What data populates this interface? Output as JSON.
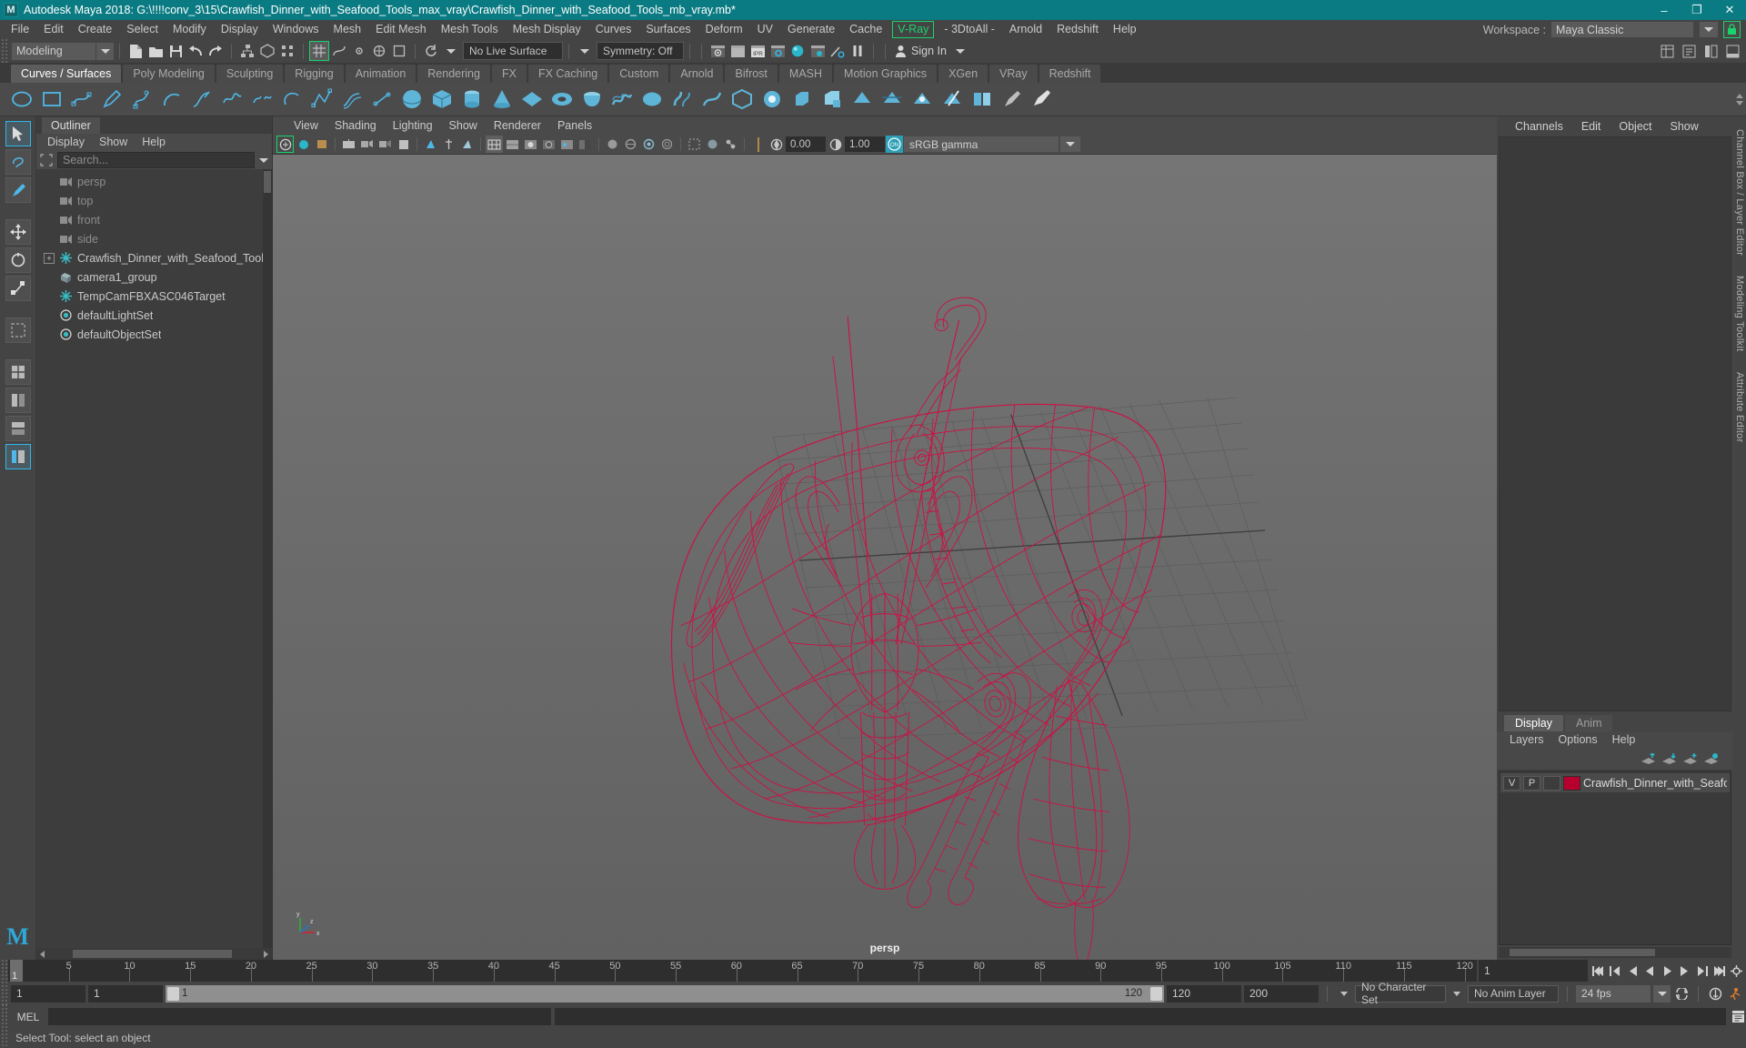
{
  "titlebar": {
    "app_title": "Autodesk Maya 2018: G:\\!!!!conv_3\\15\\Crawfish_Dinner_with_Seafood_Tools_max_vray\\Crawfish_Dinner_with_Seafood_Tools_mb_vray.mb*",
    "logo": "M",
    "minimize": "–",
    "maximize": "❐",
    "close": "✕",
    "bg_color": "#0a7b82"
  },
  "menubar": {
    "items": [
      "File",
      "Edit",
      "Create",
      "Select",
      "Modify",
      "Display",
      "Windows",
      "Mesh",
      "Edit Mesh",
      "Mesh Tools",
      "Mesh Display",
      "Curves",
      "Surfaces",
      "Deform",
      "UV",
      "Generate",
      "Cache"
    ],
    "vray": "V-Ray",
    "vray_color": "#19d36c",
    "after_vray": [
      "- 3DtoAll -",
      "Arnold",
      "Redshift",
      "Help"
    ],
    "workspace_label": "Workspace :",
    "workspace_value": "Maya Classic",
    "lock_icon": "lock-icon"
  },
  "statusline": {
    "mode_value": "Modeling",
    "no_live_surface": "No Live Surface",
    "symmetry": "Symmetry: Off",
    "sign_in": "Sign In"
  },
  "shelf": {
    "tabs": [
      "Curves / Surfaces",
      "Poly Modeling",
      "Sculpting",
      "Rigging",
      "Animation",
      "Rendering",
      "FX",
      "FX Caching",
      "Custom",
      "Arnold",
      "Bifrost",
      "MASH",
      "Motion Graphics",
      "XGen",
      "VRay",
      "Redshift"
    ],
    "active_tab": "Curves / Surfaces"
  },
  "outliner": {
    "tab": "Outliner",
    "menus": [
      "Display",
      "Show",
      "Help"
    ],
    "search_placeholder": "Search...",
    "items": [
      {
        "label": "persp",
        "icon": "camera-icon",
        "dim": true,
        "expand": false
      },
      {
        "label": "top",
        "icon": "camera-icon",
        "dim": true,
        "expand": false
      },
      {
        "label": "front",
        "icon": "camera-icon",
        "dim": true,
        "expand": false
      },
      {
        "label": "side",
        "icon": "camera-icon",
        "dim": true,
        "expand": false
      },
      {
        "label": "Crawfish_Dinner_with_Seafood_Tools",
        "icon": "transform-icon",
        "dim": false,
        "expand": true
      },
      {
        "label": "camera1_group",
        "icon": "group-icon",
        "dim": false,
        "expand": false
      },
      {
        "label": "TempCamFBXASC046Target",
        "icon": "transform-icon",
        "dim": false,
        "expand": false
      },
      {
        "label": "defaultLightSet",
        "icon": "set-icon",
        "dim": false,
        "expand": false
      },
      {
        "label": "defaultObjectSet",
        "icon": "set-icon",
        "dim": false,
        "expand": false
      }
    ]
  },
  "viewport": {
    "menus": [
      "View",
      "Shading",
      "Lighting",
      "Show",
      "Renderer",
      "Panels"
    ],
    "exposure_value": "0.00",
    "gamma_value": "1.00",
    "color_management": "sRGB gamma",
    "camera_label": "persp",
    "background_color": "#6b6b6b",
    "wireframe_color": "#cc1144",
    "axis_labels": [
      "x",
      "y",
      "z"
    ]
  },
  "channelbox": {
    "menus": [
      "Channels",
      "Edit",
      "Object",
      "Show"
    ],
    "rails": [
      "Channel Box / Layer Editor",
      "Modeling Toolkit",
      "Attribute Editor"
    ]
  },
  "layer_editor": {
    "tabs": [
      "Display",
      "Anim"
    ],
    "active_tab": "Display",
    "menus": [
      "Layers",
      "Options",
      "Help"
    ],
    "layers": [
      {
        "visible": "V",
        "playback": "P",
        "shading": "",
        "color": "#b8002e",
        "name": "Crawfish_Dinner_with_Seafoo"
      }
    ]
  },
  "timeline": {
    "current_frame": "1",
    "ticks": [
      5,
      10,
      15,
      20,
      25,
      30,
      35,
      40,
      45,
      50,
      55,
      60,
      65,
      70,
      75,
      80,
      85,
      90,
      95,
      100,
      105,
      110,
      115,
      120
    ],
    "frame_field": "1",
    "start_field": "1",
    "range_start_field": "1",
    "range_label_left": "1",
    "range_label_right": "120",
    "end_field": "120",
    "playback_end_field": "200",
    "character_set": "No Character Set",
    "anim_layer": "No Anim Layer",
    "fps": "24 fps"
  },
  "command_line": {
    "label": "MEL",
    "input_value": ""
  },
  "statusbar": {
    "message": "Select Tool: select an object"
  }
}
